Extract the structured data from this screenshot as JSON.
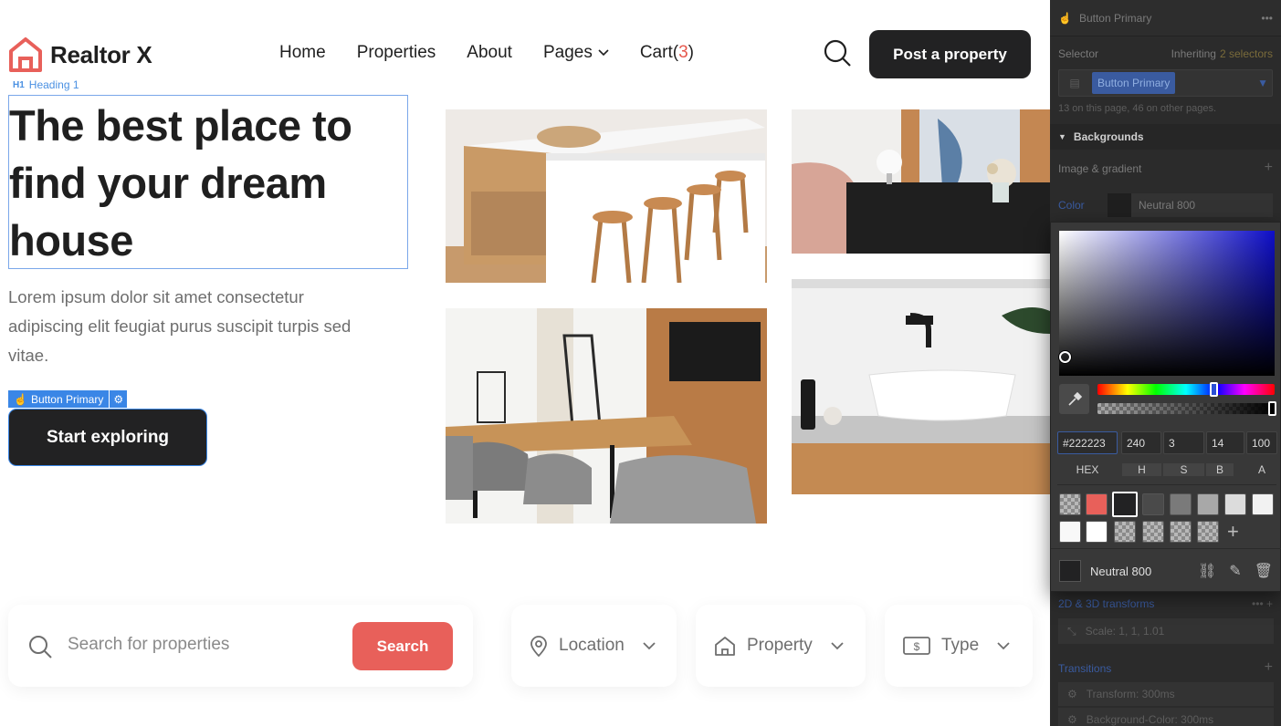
{
  "brand": {
    "name": "Realtor X",
    "accent": "#e8605a",
    "dark": "#222223"
  },
  "nav": {
    "items": [
      "Home",
      "Properties",
      "About",
      "Pages"
    ],
    "cart_label": "Cart(",
    "cart_count": "3",
    "cart_close": ")",
    "post_button": "Post a property"
  },
  "selection": {
    "heading_tag": "Heading 1",
    "button_tag": "Button Primary"
  },
  "hero": {
    "title": "The best place to find your dream house",
    "paragraph": "Lorem ipsum dolor sit amet consectetur adipiscing elit feugiat purus suscipit turpis sed vitae.",
    "cta": "Start exploring"
  },
  "search": {
    "placeholder": "Search for properties",
    "button": "Search"
  },
  "filters": {
    "location": "Location",
    "property": "Property",
    "type": "Type"
  },
  "panel": {
    "header": "Button Primary",
    "selector_label": "Selector",
    "inheriting": "Inheriting",
    "inheriting_count": "2 selectors",
    "selector_value": "Button Primary",
    "usage": "13 on this page, 46 on other pages.",
    "backgrounds": "Backgrounds",
    "image_gradient": "Image & gradient",
    "color_label": "Color",
    "color_value": "Neutral 800",
    "hex": "#222223",
    "h": "240",
    "s": "3",
    "b": "14",
    "a": "100",
    "hex_label": "HEX",
    "h_label": "H",
    "s_label": "S",
    "b_label": "B",
    "a_label": "A",
    "swatch_name": "Neutral 800",
    "transforms_label": "2D & 3D transforms",
    "scale": "Scale: 1, 1, 1.01",
    "transitions_label": "Transitions",
    "transition1": "Transform: 300ms",
    "transition2": "Background-Color: 300ms"
  }
}
